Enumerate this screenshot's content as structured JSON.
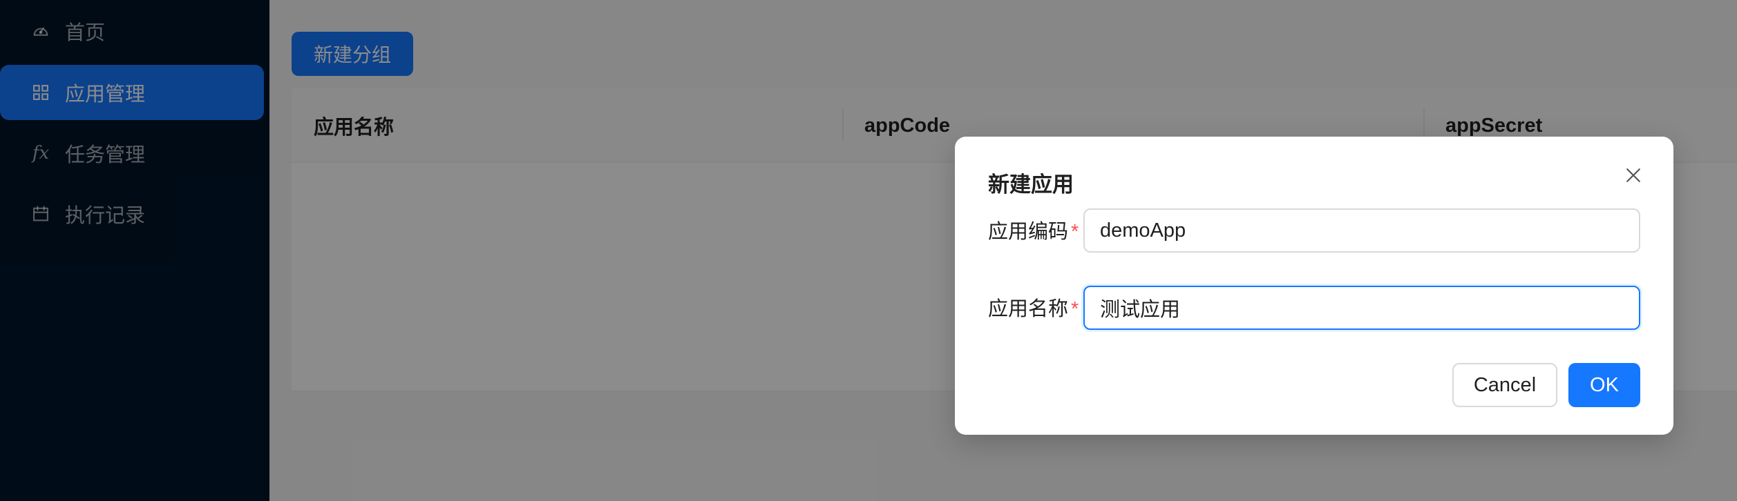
{
  "sidebar": {
    "items": [
      {
        "label": "首页",
        "icon": "dashboard-icon",
        "active": false
      },
      {
        "label": "应用管理",
        "icon": "appstore-icon",
        "active": true
      },
      {
        "label": "任务管理",
        "icon": "function-icon",
        "active": false
      },
      {
        "label": "执行记录",
        "icon": "calendar-icon",
        "active": false
      }
    ],
    "function_icon_text": "fx"
  },
  "toolbar": {
    "new_group_label": "新建分组"
  },
  "table": {
    "columns": [
      "应用名称",
      "appCode",
      "appSecret"
    ]
  },
  "modal": {
    "title": "新建应用",
    "fields": [
      {
        "label": "应用编码",
        "value": "demoApp",
        "required_mark": "*"
      },
      {
        "label": "应用名称",
        "value": "测试应用",
        "required_mark": "*"
      }
    ],
    "cancel_label": "Cancel",
    "ok_label": "OK"
  },
  "colors": {
    "sidebar_bg": "#001529",
    "primary": "#1677ff",
    "required": "#ff4d4f"
  }
}
